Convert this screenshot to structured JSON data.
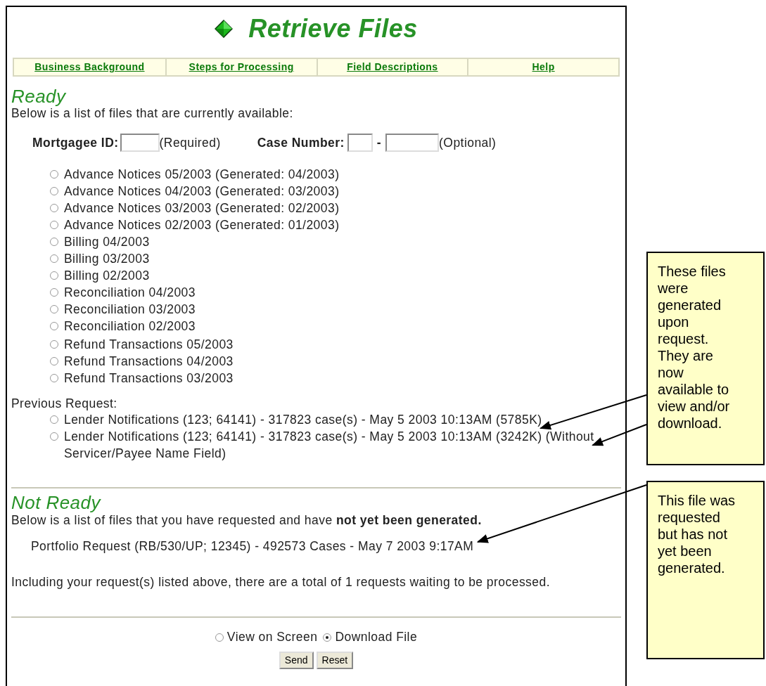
{
  "title": "Retrieve Files",
  "nav_links": [
    "Business Background",
    "Steps for Processing",
    "Field Descriptions",
    "Help"
  ],
  "ready": {
    "heading": "Ready",
    "description": "Below is a list of files that are currently available:",
    "filters": {
      "mortgagee_label": "Mortgagee ID:",
      "mortgagee_note": "(Required)",
      "case_label": "Case Number:",
      "case_separator": "-",
      "case_note": "(Optional)"
    },
    "file_groups": [
      [
        {
          "label": "Advance Notices 05/2003 (Generated: 04/2003)",
          "selected": false
        },
        {
          "label": "Advance Notices 04/2003 (Generated: 03/2003)",
          "selected": false
        },
        {
          "label": "Advance Notices 03/2003 (Generated: 02/2003)",
          "selected": false
        },
        {
          "label": "Advance Notices 02/2003 (Generated: 01/2003)",
          "selected": false
        },
        {
          "label": "Billing 04/2003",
          "selected": false
        },
        {
          "label": "Billing 03/2003",
          "selected": false
        },
        {
          "label": "Billing 02/2003",
          "selected": false
        },
        {
          "label": "Reconciliation 04/2003",
          "selected": false
        },
        {
          "label": "Reconciliation 03/2003",
          "selected": false
        },
        {
          "label": "Reconciliation 02/2003",
          "selected": false
        }
      ],
      [
        {
          "label": "Refund Transactions 05/2003",
          "selected": false
        },
        {
          "label": "Refund Transactions 04/2003",
          "selected": false
        },
        {
          "label": "Refund Transactions 03/2003",
          "selected": false
        }
      ]
    ],
    "previous_request": {
      "label": "Previous Request:",
      "files": [
        {
          "label": "Lender Notifications (123; 64141) - 317823 case(s) - May 5 2003 10:13AM (5785K)",
          "selected": false
        },
        {
          "label": "Lender Notifications (123; 64141) - 317823 case(s) - May 5 2003 10:13AM (3242K) (Without Servicer/Payee Name Field)",
          "selected": false
        }
      ]
    }
  },
  "not_ready": {
    "heading": "Not Ready",
    "description": "Below is a list of files that you have requested and have **not yet been generated.**",
    "pending": [
      "Portfolio Request (RB/530/UP; 12345) - 492573 Cases - May 7 2003 9:17AM"
    ],
    "total_note": "Including your request(s) listed above, there are a total of 1 requests waiting to be processed."
  },
  "output_options": [
    {
      "label": "View on Screen",
      "selected": false
    },
    {
      "label": "Download File",
      "selected": true
    }
  ],
  "buttons": [
    "Send",
    "Reset"
  ],
  "callouts": [
    {
      "text": "These files were generated upon request. They are now available to view and/or download."
    },
    {
      "text": "This file was requested but has not yet been generated."
    }
  ]
}
